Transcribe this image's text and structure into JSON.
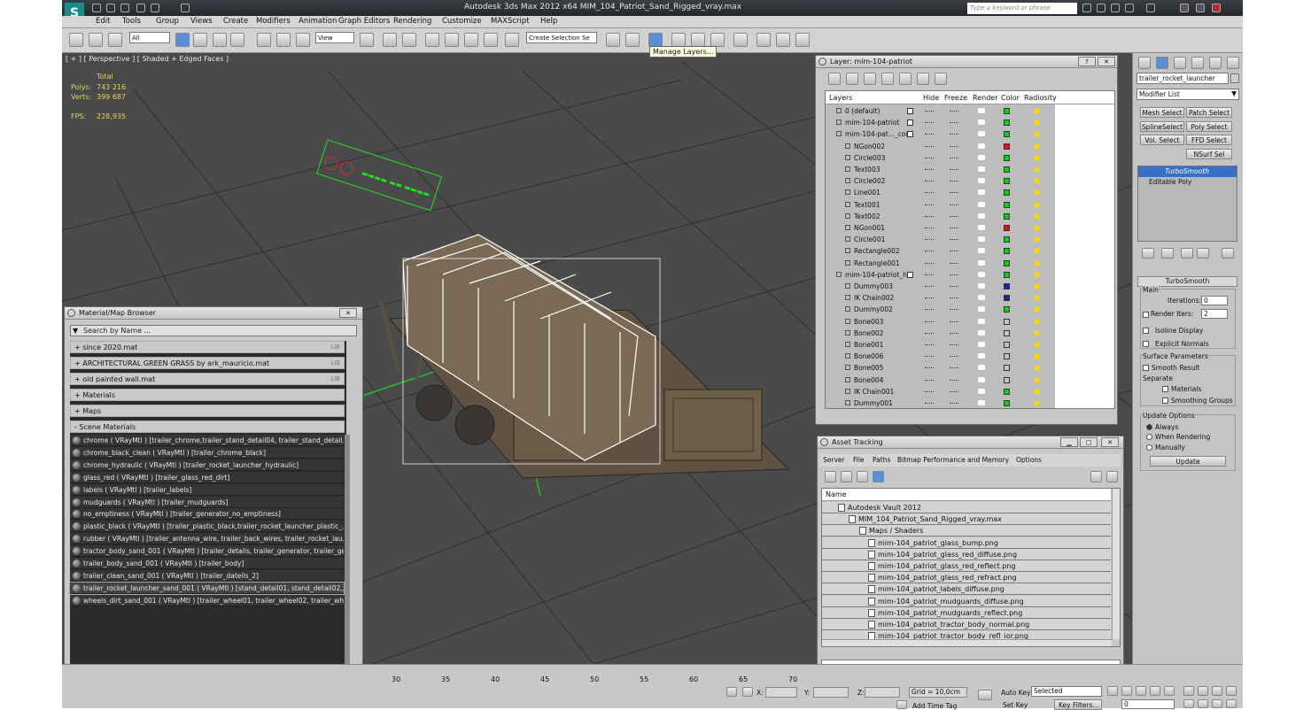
{
  "app": {
    "title": "Autodesk 3ds Max  2012 x64     MIM_104_Patriot_Sand_Rigged_vray.max",
    "search_placeholder": "Type a keyword or phrase",
    "logo": "S"
  },
  "menu": [
    "Edit",
    "Tools",
    "Group",
    "Views",
    "Create",
    "Modifiers",
    "Animation",
    "Graph Editors",
    "Rendering",
    "Customize",
    "MAXScript",
    "Help"
  ],
  "toolbar": {
    "selection_filter": "All",
    "coord_system": "View",
    "named_selection": "Create Selection Se",
    "tooltip": "Manage Layers..."
  },
  "viewport": {
    "label": "[ + ] [ Perspective ] [ Shaded + Edged Faces ]",
    "stats": {
      "total": "Total",
      "polys_label": "Polys:",
      "polys": "743 216",
      "verts_label": "Verts:",
      "verts": "399 687",
      "fps_label": "FPS:",
      "fps": "228,935"
    }
  },
  "layers": {
    "title": "Layer: mim-104-patriot",
    "columns": [
      "Layers",
      "Hide",
      "Freeze",
      "Render",
      "Color",
      "Radiosity"
    ],
    "rows": [
      {
        "name": "0 (default)",
        "indent": 0,
        "color": "#18c818"
      },
      {
        "name": "mim-104-patriot",
        "indent": 0,
        "color": "#18c818"
      },
      {
        "name": "mim-104-pat..._con",
        "indent": 0,
        "color": "#18c818"
      },
      {
        "name": "NGon002",
        "indent": 1,
        "color": "#d81818"
      },
      {
        "name": "Circle003",
        "indent": 1,
        "color": "#18c818"
      },
      {
        "name": "Text003",
        "indent": 1,
        "color": "#18c818"
      },
      {
        "name": "Circle002",
        "indent": 1,
        "color": "#18c818"
      },
      {
        "name": "Line001",
        "indent": 1,
        "color": "#18c818"
      },
      {
        "name": "Text001",
        "indent": 1,
        "color": "#18c818"
      },
      {
        "name": "Text002",
        "indent": 1,
        "color": "#18c818"
      },
      {
        "name": "NGon001",
        "indent": 1,
        "color": "#d81818"
      },
      {
        "name": "Circle001",
        "indent": 1,
        "color": "#18c818"
      },
      {
        "name": "Rectangle002",
        "indent": 1,
        "color": "#18c818"
      },
      {
        "name": "Rectangle001",
        "indent": 1,
        "color": "#18c818"
      },
      {
        "name": "mim-104-patriot_hel",
        "indent": 0,
        "color": "#18c818"
      },
      {
        "name": "Dummy003",
        "indent": 1,
        "color": "#1a2a8a"
      },
      {
        "name": "IK Chain002",
        "indent": 1,
        "color": "#1a2a8a"
      },
      {
        "name": "Dummy002",
        "indent": 1,
        "color": "#18c818"
      },
      {
        "name": "Bone003",
        "indent": 1,
        "color": "#c0c4d0"
      },
      {
        "name": "Bone002",
        "indent": 1,
        "color": "#c0c4d0"
      },
      {
        "name": "Bone001",
        "indent": 1,
        "color": "#c0c4d0"
      },
      {
        "name": "Bone006",
        "indent": 1,
        "color": "#c0c4d0"
      },
      {
        "name": "Bone005",
        "indent": 1,
        "color": "#c0c4d0"
      },
      {
        "name": "Bone004",
        "indent": 1,
        "color": "#c0c4d0"
      },
      {
        "name": "IK Chain001",
        "indent": 1,
        "color": "#18c818"
      },
      {
        "name": "Dummy001",
        "indent": 1,
        "color": "#18c818"
      }
    ]
  },
  "material_browser": {
    "title": "Material/Map Browser",
    "search_placeholder": "Search by Name ...",
    "groups": [
      {
        "label": "+ since 2020.mat",
        "tag": "LIB"
      },
      {
        "label": "+ ARCHITECTURAL GREEN GRASS by ark_mauricio.mat",
        "tag": "LIB"
      },
      {
        "label": "+ old painted wall.mat",
        "tag": "LIB"
      },
      {
        "label": "+ Materials",
        "tag": ""
      },
      {
        "label": "+ Maps",
        "tag": ""
      },
      {
        "label": "- Scene Materials",
        "tag": ""
      }
    ],
    "materials": [
      "chrome  ( VRayMtl ) [trailer_chrome,trailer_stand_detail04, trailer_stand_detail...",
      "chrome_black_clean  ( VRayMtl ) [trailer_chrome_black]",
      "chrome_hydraulic  ( VRayMtl ) [trailer_rocket_launcher_hydraulic]",
      "glass_red  ( VRayMtl ) [trailer_glass_red_dirt]",
      "labels  ( VRayMtl ) [trailer_labels]",
      "mudguards  ( VRayMtl ) [trailer_mudguards]",
      "no_emptiness  ( VRayMtl ) [trailer_generator_no_emptiness]",
      "plastic_black  ( VRayMtl ) [trailer_plastic_black,trailer_rocket_launcher_plastic_...",
      "rubber  ( VRayMtl ) [trailer_antenna_wire, trailer_back_wires, trailer_rocket_lau...",
      "tractor_body_sand_001  ( VRayMtl ) [trailer_details, trailer_generator, trailer_ge...",
      "trailer_body_sand_001  ( VRayMtl ) [trailer_body]",
      "trailer_clean_sand_001  ( VRayMtl ) [trailer_dateils_2]",
      "trailer_rocket_launcher_sand_001  ( VRayMtl ) [stand_detail01, stand_detail02,...",
      "wheels_dirt_sand_001  ( VRayMtl ) [trailer_wheel01, trailer_wheel02, trailer_wh..."
    ]
  },
  "asset_tracking": {
    "title": "Asset Tracking",
    "menu": [
      "Server",
      "File",
      "Paths",
      "Bitmap Performance and Memory",
      "Options"
    ],
    "column": "Name",
    "rows": [
      {
        "name": "Autodesk Vault 2012",
        "level": 0
      },
      {
        "name": "MIM_104_Patriot_Sand_Rigged_vray.max",
        "level": 1
      },
      {
        "name": "Maps / Shaders",
        "level": 2
      },
      {
        "name": "mim-104_patriot_glass_bump.png",
        "level": 3
      },
      {
        "name": "mim-104_patriot_glass_red_diffuse.png",
        "level": 3
      },
      {
        "name": "mim-104_patriot_glass_red_reflect.png",
        "level": 3
      },
      {
        "name": "mim-104_patriot_glass_red_refract.png",
        "level": 3
      },
      {
        "name": "mim-104_patriot_labels_diffuse.png",
        "level": 3
      },
      {
        "name": "mim-104_patriot_mudguards_diffuse.png",
        "level": 3
      },
      {
        "name": "mim-104_patriot_mudguards_reflect.png",
        "level": 3
      },
      {
        "name": "mim-104_patriot_tractor_body_normal.png",
        "level": 3
      },
      {
        "name": "mim-104_patriot_tractor_body_refl_ior.png",
        "level": 3
      }
    ]
  },
  "command_panel": {
    "object_name": "trailer_rocket_launcher",
    "modifier_list": "Modifier List",
    "buttons": [
      "Mesh Select",
      "Patch Select",
      "SplineSelect",
      "Poly Select",
      "Vol. Select",
      "FFD Select",
      "NSurf Sel"
    ],
    "stack": [
      "TurboSmooth",
      "Editable Poly"
    ],
    "rollout": "TurboSmooth",
    "main": "Main",
    "iterations_label": "Iterations:",
    "iterations": "0",
    "render_iters_label": "Render Iters:",
    "render_iters": "2",
    "isoline": "Isoline Display",
    "explicit": "Explicit Normals",
    "surface": "Surface Parameters",
    "smooth_result": "Smooth Result",
    "separate": "Separate",
    "materials": "Materials",
    "smoothing_groups": "Smoothing Groups",
    "update_options": "Update Options",
    "always": "Always",
    "when_rendering": "When Rendering",
    "manually": "Manually",
    "update": "Update"
  },
  "timeline": {
    "ticks": [
      "30",
      "35",
      "40",
      "45",
      "50",
      "55",
      "60",
      "65",
      "70"
    ],
    "x_label": "X:",
    "y_label": "Y:",
    "z_label": "Z:",
    "grid": "Grid = 10,0cm",
    "auto_key": "Auto Key",
    "selected": "Selected",
    "set_key": "Set Key",
    "key_filters": "Key Filters...",
    "add_time_tag": "Add Time Tag",
    "frame": "0"
  }
}
